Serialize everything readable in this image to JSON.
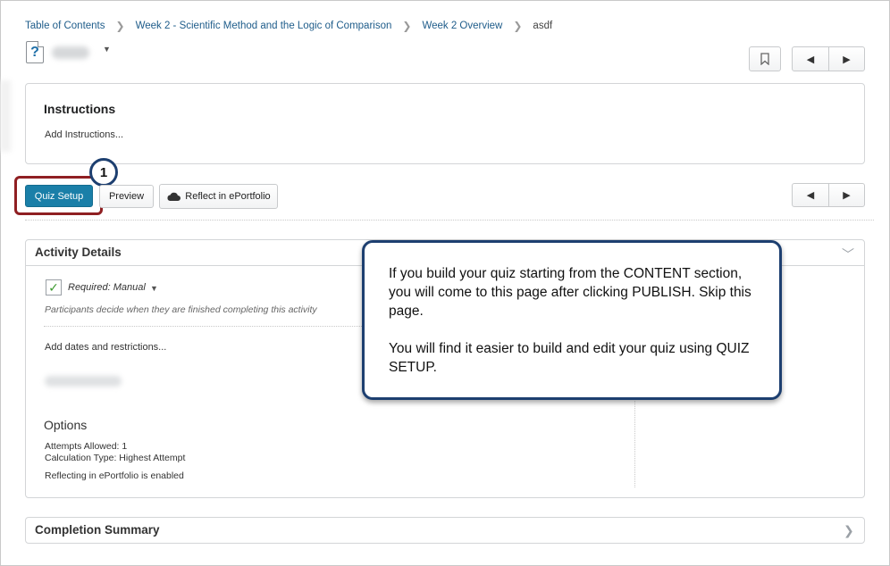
{
  "breadcrumb": {
    "items": [
      "Table of Contents",
      "Week 2 - Scientific Method and the Logic of Comparison",
      "Week 2 Overview"
    ],
    "current": "asdf"
  },
  "nav": {
    "prev_icon": "prev-icon",
    "next_icon": "next-icon",
    "bookmark_icon": "bookmark-icon"
  },
  "instructions": {
    "title": "Instructions",
    "add_link": "Add Instructions..."
  },
  "actions": {
    "quiz_setup": "Quiz Setup",
    "preview": "Preview",
    "reflect": "Reflect in ePortfolio",
    "step_number": "1"
  },
  "activity": {
    "title": "Activity Details",
    "required": "Required: Manual",
    "participants_note": "Participants decide when they are finished completing this activity",
    "add_dates": "Add dates and restrictions...",
    "options_title": "Options",
    "attempts": "Attempts Allowed: 1",
    "calc_type": "Calculation Type: Highest Attempt",
    "reflecting": "Reflecting in ePortfolio is enabled"
  },
  "completion": {
    "title": "Completion Summary"
  },
  "callout": {
    "paragraph1": "If you build your quiz starting from the CONTENT section, you will come to this page after clicking PUBLISH.  Skip this page.",
    "paragraph2": "You will find it easier to build and edit your quiz using QUIZ SETUP."
  },
  "colors": {
    "primary_button": "#1a7fa8",
    "highlight_border": "#8f1f22",
    "callout_border": "#1d3f70",
    "link": "#1e5c8a"
  }
}
